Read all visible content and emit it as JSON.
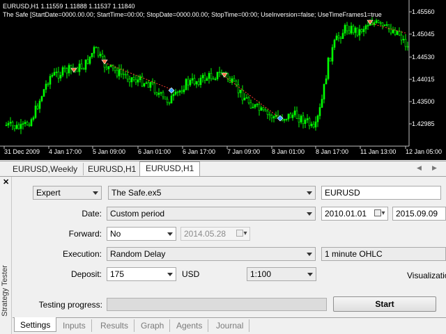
{
  "chart": {
    "title": "EURUSD,H1  1.11559 1.11888 1.11537 1.11840",
    "subtitle": "The Safe [StartDate=0000.00.00; StartTime=00:00; StopDate=0000.00.00; StopTime=00:00; UseInversion=false; UseTimeFrames1=true",
    "price_labels": [
      "1.45560",
      "1.45045",
      "1.44530",
      "1.44015",
      "1.43500",
      "1.42985"
    ],
    "time_labels": [
      "31 Dec 2009",
      "4 Jan 17:00",
      "5 Jan 09:00",
      "6 Jan 01:00",
      "6 Jan 17:00",
      "7 Jan 09:00",
      "8 Jan 01:00",
      "8 Jan 17:00",
      "11 Jan 13:00",
      "12 Jan 05:00"
    ],
    "colors": {
      "background": "#000000",
      "candles": "#00ff00",
      "text": "#ffffff",
      "trade_line": "#ff3b30"
    }
  },
  "chart_tabs": [
    "EURUSD,Weekly",
    "EURUSD,H1",
    "EURUSD,H1"
  ],
  "tester": {
    "panel_title": "Strategy Tester",
    "program_type": "Expert",
    "expert": "The Safe.ex5",
    "symbol": "EURUSD",
    "date_label": "Date:",
    "date_mode": "Custom period",
    "date_from": "2010.01.01",
    "date_to": "2015.09.09",
    "forward_label": "Forward:",
    "forward": "No",
    "forward_date": "2014.05.28",
    "execution_label": "Execution:",
    "execution": "Random Delay",
    "model": "1 minute OHLC",
    "deposit_label": "Deposit:",
    "deposit": "175",
    "currency": "USD",
    "leverage": "1:100",
    "visualization_label": "Visualization",
    "progress_label": "Testing progress:",
    "start_label": "Start"
  },
  "bottom_tabs": [
    "Settings",
    "Inputs",
    "Results",
    "Graph",
    "Agents",
    "Journal"
  ]
}
